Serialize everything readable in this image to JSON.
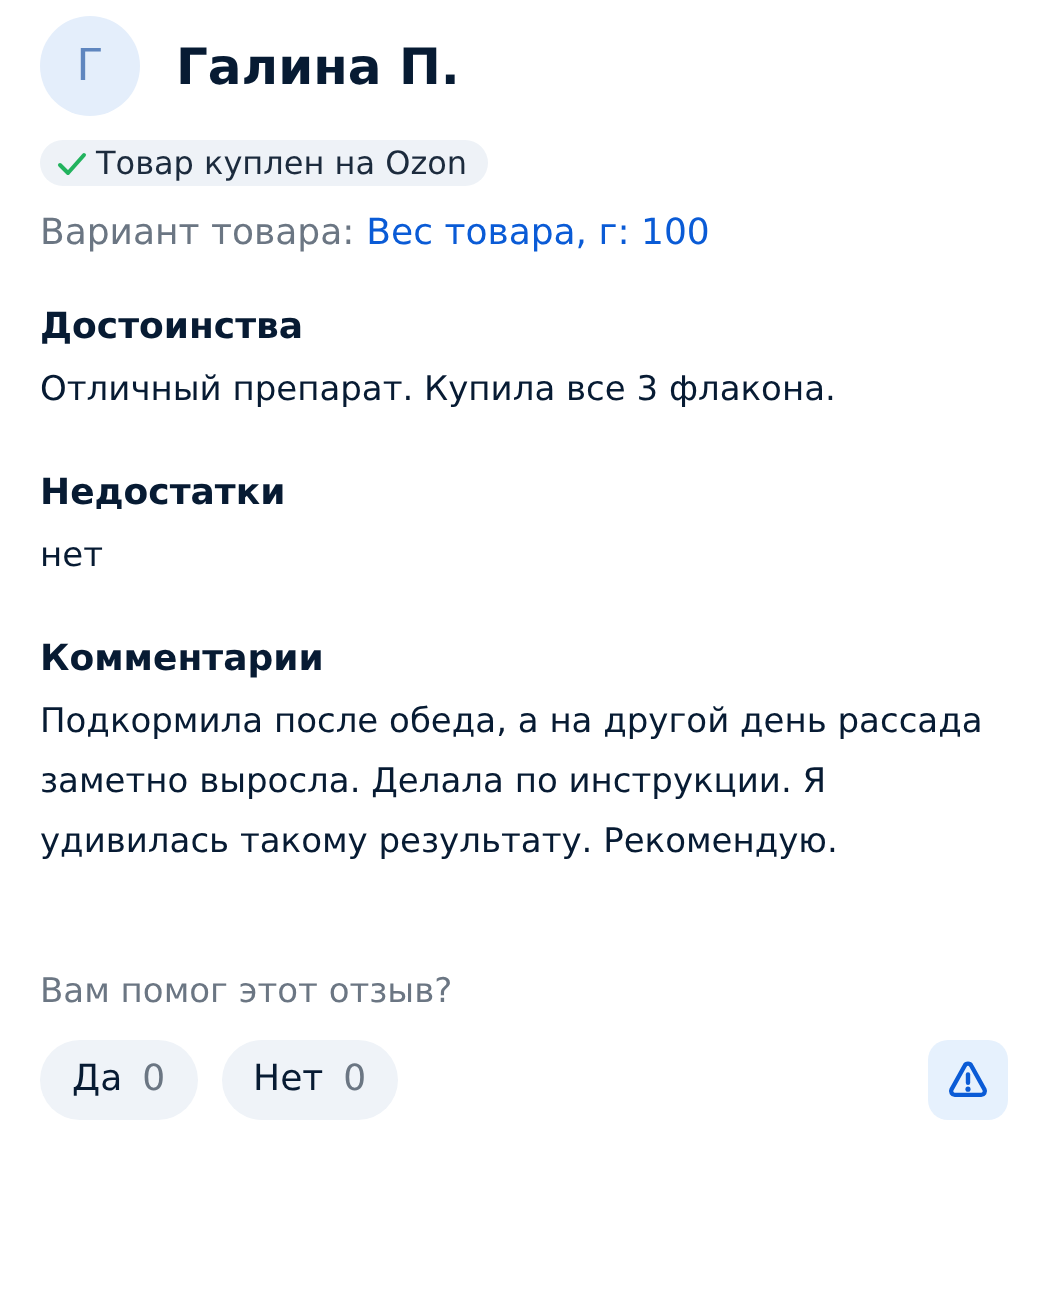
{
  "author": {
    "initial": "Г",
    "name": "Галина П."
  },
  "purchase_badge": {
    "verified": true,
    "label": "Товар куплен на Ozon"
  },
  "variant": {
    "label": "Вариант товара:",
    "value": "Вес товара, г: 100"
  },
  "sections": [
    {
      "heading": "Достоинства",
      "text": "Отличный препарат. Купила все 3 флакона."
    },
    {
      "heading": "Недостатки",
      "text": "нет"
    },
    {
      "heading": "Комментарии",
      "text": "Подкормила после обеда, а на другой день рассада заметно выросла. Делала по инструкции. Я удивилась такому результату. Рекомендую."
    }
  ],
  "helpful": {
    "question": "Вам помог этот отзыв?",
    "buttons": [
      {
        "label": "Да",
        "count": "0"
      },
      {
        "label": "Нет",
        "count": "0"
      }
    ]
  }
}
